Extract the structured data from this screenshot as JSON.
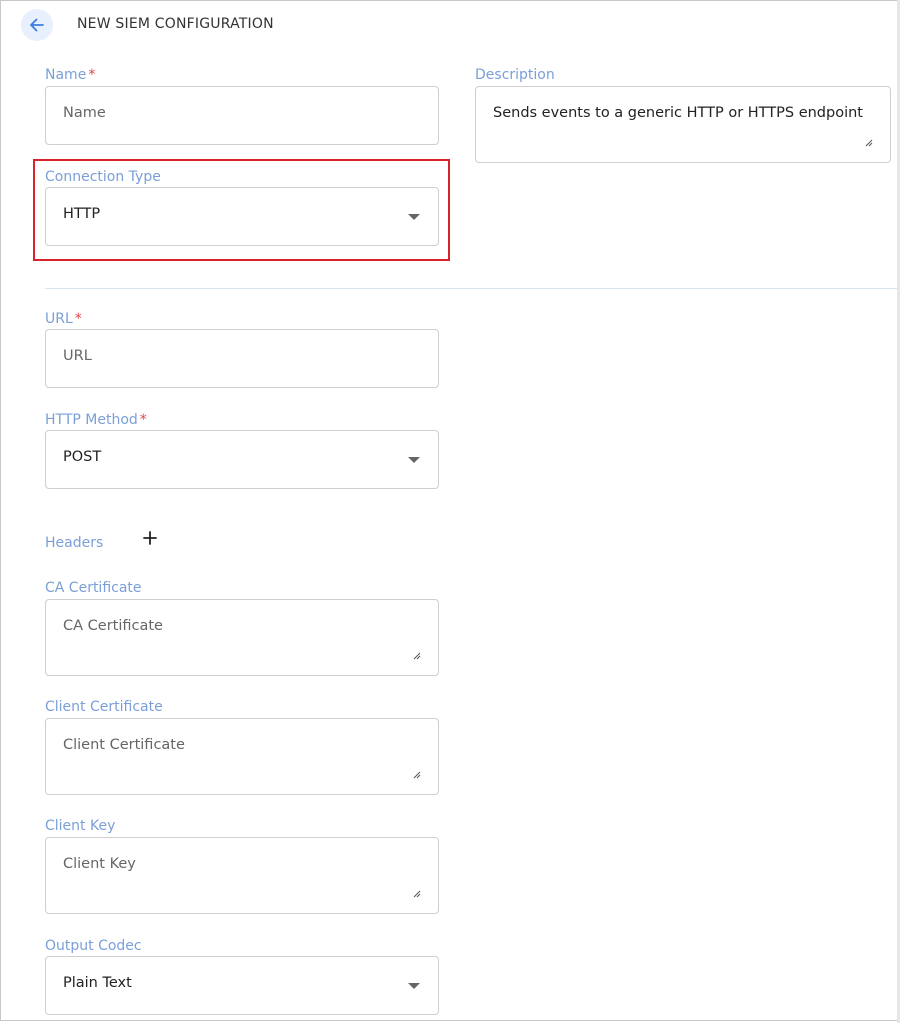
{
  "header": {
    "title": "NEW SIEM CONFIGURATION"
  },
  "required_marker": "*",
  "fields": {
    "name": {
      "label": "Name",
      "placeholder": "Name"
    },
    "description": {
      "label": "Description",
      "value": "Sends events to a generic HTTP or HTTPS endpoint"
    },
    "connection_type": {
      "label": "Connection Type",
      "value": "HTTP"
    },
    "url": {
      "label": "URL",
      "placeholder": "URL"
    },
    "http_method": {
      "label": "HTTP Method",
      "value": "POST"
    },
    "headers": {
      "label": "Headers"
    },
    "ca_certificate": {
      "label": "CA Certificate",
      "placeholder": "CA Certificate"
    },
    "client_certificate": {
      "label": "Client Certificate",
      "placeholder": "Client Certificate"
    },
    "client_key": {
      "label": "Client Key",
      "placeholder": "Client Key"
    },
    "output_codec": {
      "label": "Output Codec",
      "value": "Plain Text"
    }
  },
  "colors": {
    "label": "#7a9fd8",
    "required": "#e0454b",
    "highlight": "#d8232a",
    "back_button_bg": "#e8f0fd"
  },
  "icons": {
    "back": "arrow-left-icon",
    "dropdown": "chevron-down-icon",
    "add": "plus-icon",
    "resize": "resize-handle-icon"
  }
}
